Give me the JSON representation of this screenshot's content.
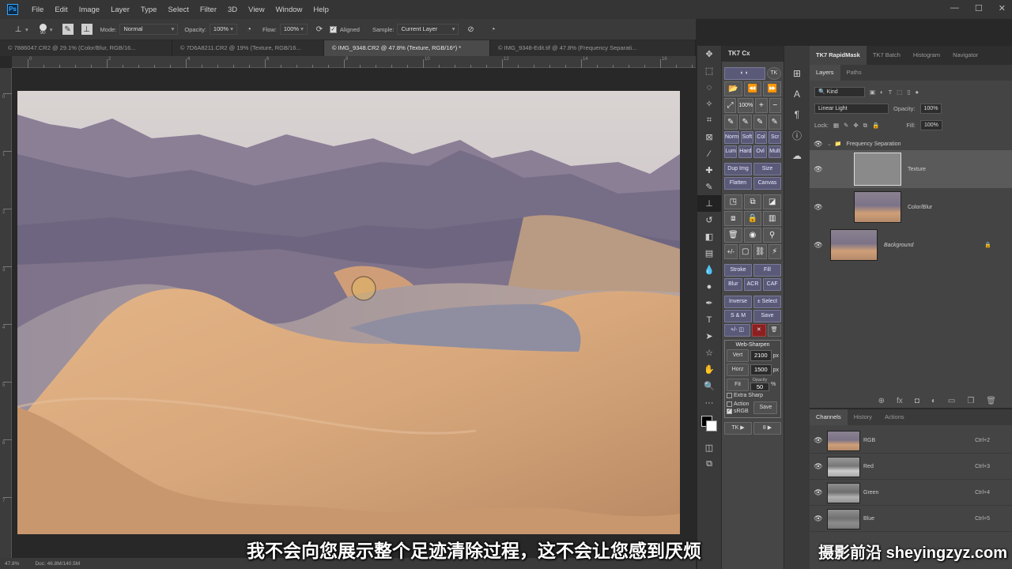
{
  "app": {
    "logo": "Ps"
  },
  "menu": [
    "File",
    "Edit",
    "Image",
    "Layer",
    "Type",
    "Select",
    "Filter",
    "3D",
    "View",
    "Window",
    "Help"
  ],
  "window_controls": [
    "—",
    "☐",
    "✕"
  ],
  "options": {
    "brush_size": "90",
    "mode_label": "Mode:",
    "mode_value": "Normal",
    "opacity_label": "Opacity:",
    "opacity_value": "100%",
    "flow_label": "Flow:",
    "flow_value": "100%",
    "aligned_label": "Aligned",
    "sample_label": "Sample:",
    "sample_value": "Current Layer"
  },
  "doc_tabs": [
    {
      "label": "© 7886047.CR2 @ 29.1% (Color/Blur, RGB/16...",
      "active": false
    },
    {
      "label": "© 7D6A8211.CR2 @ 19% (Texture, RGB/16...",
      "active": false
    },
    {
      "label": "© IMG_9348.CR2 @ 47.8% (Texture, RGB/16*) *",
      "active": true
    },
    {
      "label": "© IMG_9348-Edit.tif @ 47.8% (Frequency Separati...",
      "active": false
    }
  ],
  "ruler_top_labels": [
    "0",
    "2",
    "4",
    "6",
    "8",
    "10",
    "12",
    "14",
    "16"
  ],
  "ruler_left_labels": [
    "0",
    "1",
    "2",
    "3",
    "4",
    "5",
    "6",
    "7"
  ],
  "status": {
    "zoom": "47.8%",
    "doc": "Doc: 46.8M/140.5M"
  },
  "tk7": {
    "header": "TK7 Cx",
    "blend_row1": [
      "Norm",
      "Soft",
      "Col",
      "Scr"
    ],
    "blend_row2": [
      "Lum",
      "Hard",
      "Ovl",
      "Mult"
    ],
    "zoom_pct": "100%",
    "row_dup": [
      "Dup Img",
      "Size"
    ],
    "row_flat": [
      "Flatten",
      "Canvas"
    ],
    "row_stroke": [
      "Stroke",
      "Fill"
    ],
    "row_blur": [
      "Blur",
      "ACR",
      "CAF"
    ],
    "row_inverse": [
      "Inverse",
      "± Select"
    ],
    "row_sm": [
      "S & M",
      "Save"
    ],
    "ws_title": "Web-Sharpen",
    "ws_vert_btn": "Vert",
    "ws_vert_val": "2100",
    "ws_horz_btn": "Horz",
    "ws_horz_val": "1500",
    "ws_unit": "px",
    "ws_fit_btn": "Fit",
    "ws_opacity_label": "Opacity",
    "ws_opacity_val": "50",
    "ws_pct": "%",
    "ws_extra": "Extra Sharp",
    "ws_action": "Action",
    "ws_srgb": "sRGB",
    "ws_save": "Save",
    "bottom_left": "TK ▶",
    "bottom_right": "8 ▶"
  },
  "right_tabs": [
    "TK7 RapidMask",
    "TK7 Batch",
    "Histogram",
    "Navigator"
  ],
  "layers": {
    "tabs": [
      "Layers",
      "Paths"
    ],
    "kind_label": "Kind",
    "blend_mode": "Linear Light",
    "opacity_label": "Opacity:",
    "opacity_value": "100%",
    "lock_label": "Lock:",
    "fill_label": "Fill:",
    "fill_value": "100%",
    "group_name": "Frequency Separation",
    "items": [
      {
        "name": "Texture"
      },
      {
        "name": "Color/Blur"
      },
      {
        "name": "Background"
      }
    ],
    "footer_icons": [
      "⊕",
      "fx",
      "◘",
      "◐",
      "▭",
      "❐",
      "🗑"
    ]
  },
  "channels": {
    "tabs": [
      "Channels",
      "History",
      "Actions"
    ],
    "items": [
      {
        "name": "RGB",
        "shortcut": "Ctrl+2"
      },
      {
        "name": "Red",
        "shortcut": "Ctrl+3"
      },
      {
        "name": "Green",
        "shortcut": "Ctrl+4"
      },
      {
        "name": "Blue",
        "shortcut": "Ctrl+5"
      }
    ]
  },
  "subtitle": "我不会向您展示整个足迹清除过程，这不会让您感到厌烦",
  "watermark": "摄影前沿 sheyingzyz.com"
}
